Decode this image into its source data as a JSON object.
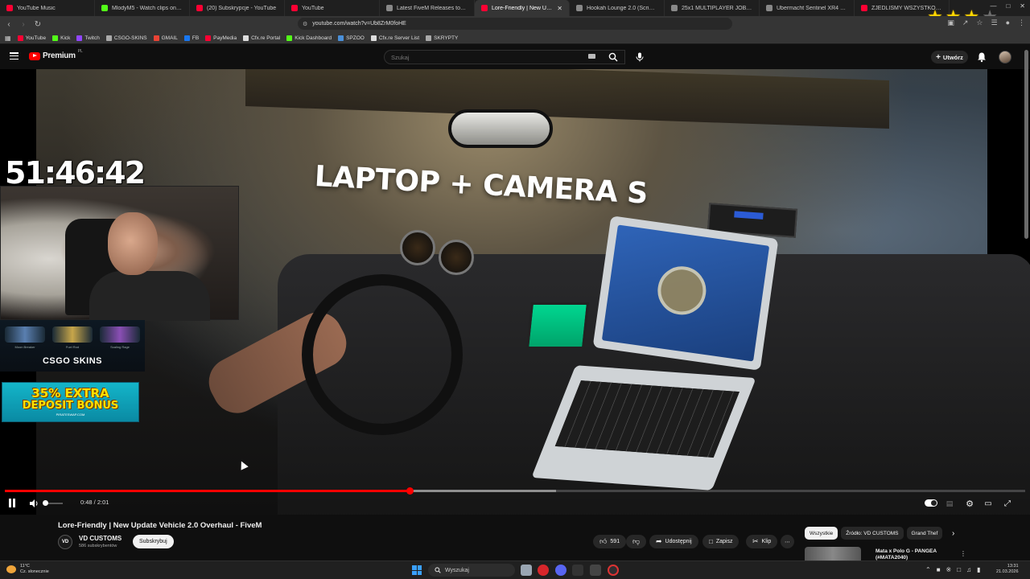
{
  "browser": {
    "tabs": [
      {
        "label": "YouTube Music",
        "color": "#ff0033"
      },
      {
        "label": "MlodyM5 - Watch clips on Kick",
        "color": "#53fc18"
      },
      {
        "label": "(20) Subskrypcje - YouTube",
        "color": "#ff0033"
      },
      {
        "label": "YouTube",
        "color": "#ff0033"
      },
      {
        "label": "Latest FiveM Releases topics - Cfx.re",
        "color": "#888888"
      },
      {
        "label": "Lore-Friendly | New Update",
        "color": "#ff0033",
        "active": true
      },
      {
        "label": "Hookah Lounge 2.0 (Script & MLO)",
        "color": "#888888"
      },
      {
        "label": "25x1 MULTIPLAYER JOBS SYSTEM",
        "color": "#888888"
      },
      {
        "label": "Ubermacht Sentinel XR4 - FiveM",
        "color": "#888888"
      },
      {
        "label": "ZJEDLIŚMY WSZYSTKO W KUJ...",
        "color": "#ff0033"
      }
    ],
    "stars": [
      "★",
      "★",
      "★",
      "★"
    ],
    "window_controls": [
      "—",
      "□",
      "✕"
    ],
    "url": "youtube.com/watch?v=Ub8ZrM0foHE",
    "bookmarks": [
      {
        "label": "YouTube",
        "color": "#ff0033"
      },
      {
        "label": "Kick",
        "color": "#53fc18"
      },
      {
        "label": "Twitch",
        "color": "#9146ff"
      },
      {
        "label": "CSGO-SKINS",
        "color": "#aaaaaa"
      },
      {
        "label": "GMAIL",
        "color": "#ea4335"
      },
      {
        "label": "FB",
        "color": "#1877f2"
      },
      {
        "label": "PayMedia",
        "color": "#ff0033"
      },
      {
        "label": "Cfx.re Portal",
        "color": "#dddddd"
      },
      {
        "label": "Kick Dashboard",
        "color": "#53fc18"
      },
      {
        "label": "SPZOO",
        "color": "#4a90d9"
      },
      {
        "label": "Cfx.re Server List",
        "color": "#dddddd"
      },
      {
        "label": "SKRYPTY",
        "color": "#aaaaaa"
      }
    ]
  },
  "youtube": {
    "logo_text": "Premium",
    "logo_region": "PL",
    "search_placeholder": "Szukaj",
    "create_label": "Utwórz"
  },
  "video": {
    "overlay_text": "LAPTOP + CAMERA S",
    "stream_timer": "51:46:42",
    "skins": [
      {
        "label": "Moon Breaker",
        "color": "#5a7fb0"
      },
      {
        "label": "Fuel Rod",
        "color": "#c7a64a"
      },
      {
        "label": "Scaling Rage",
        "color": "#8a4fb5"
      }
    ],
    "sponsor": "CSGO SKINS",
    "promo_line1": "35% EXTRA",
    "promo_line2": "DEPOSIT BONUS",
    "promo_site": "PIRATESWAP.COM",
    "current_time": "0:48",
    "duration": "2:01",
    "time_display": "0:48 / 2:01",
    "played_fraction": 0.3967,
    "buffered_fraction": 0.54,
    "accent_color": "#ff0000"
  },
  "details": {
    "title": "Lore-Friendly | New Update Vehicle 2.0 Overhaul - FiveM",
    "channel_initials": "VD",
    "channel_name": "VD CUSTOMS",
    "subscribers": "586 subskrybentów",
    "subscribe_label": "Subskrybuj",
    "like_count": "591",
    "share_label": "Udostępnij",
    "save_label": "Zapisz",
    "clip_label": "Klip"
  },
  "sidebar": {
    "chips": [
      {
        "label": "Wszystkie",
        "selected": true
      },
      {
        "label": "Źródło: VD CUSTOMS"
      },
      {
        "label": "Grand Thef"
      }
    ],
    "rec_title_1": "Mata x Polo G - PANGEA",
    "rec_title_2": "(#MATA2040)"
  },
  "taskbar": {
    "weather_temp": "11°C",
    "weather_desc": "Cz. słonecznie",
    "search_label": "Wyszukaj",
    "time": "13:31",
    "date": "21.03.2026"
  }
}
